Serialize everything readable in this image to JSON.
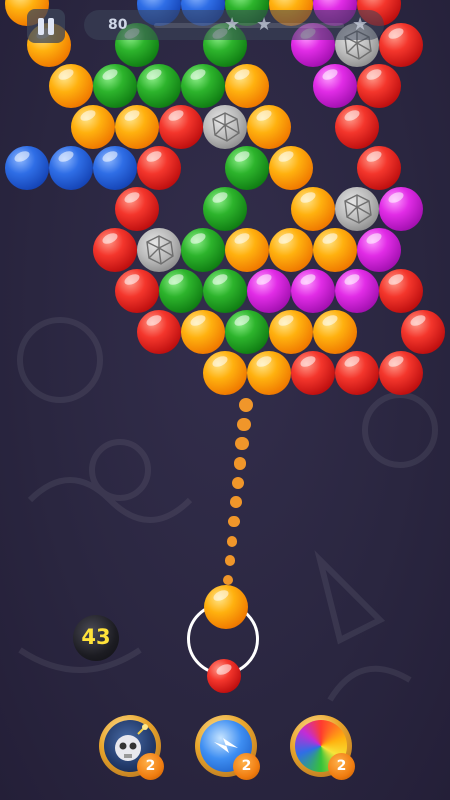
{
  "hud": {
    "score": "80"
  },
  "shots_remaining": "43",
  "loaded_bubble": "orange",
  "next_bubble": "red",
  "bubbles": [
    {
      "c": "orange",
      "col": 0,
      "row": 0
    },
    {
      "c": "blue",
      "col": 3,
      "row": 0
    },
    {
      "c": "blue",
      "col": 4,
      "row": 0
    },
    {
      "c": "green",
      "col": 5,
      "row": 0
    },
    {
      "c": "orange",
      "col": 6,
      "row": 0
    },
    {
      "c": "magenta",
      "col": 7,
      "row": 0
    },
    {
      "c": "red",
      "col": 8,
      "row": 0
    },
    {
      "c": "orange",
      "col": 0,
      "row": 1
    },
    {
      "c": "green",
      "col": 2,
      "row": 1
    },
    {
      "c": "green",
      "col": 4,
      "row": 1
    },
    {
      "c": "magenta",
      "col": 6,
      "row": 1
    },
    {
      "c": "rock",
      "col": 7,
      "row": 1
    },
    {
      "c": "red",
      "col": 8,
      "row": 1
    },
    {
      "c": "orange",
      "col": 1,
      "row": 2
    },
    {
      "c": "green",
      "col": 2,
      "row": 2
    },
    {
      "c": "green",
      "col": 3,
      "row": 2
    },
    {
      "c": "green",
      "col": 4,
      "row": 2
    },
    {
      "c": "orange",
      "col": 5,
      "row": 2
    },
    {
      "c": "magenta",
      "col": 7,
      "row": 2
    },
    {
      "c": "red",
      "col": 8,
      "row": 2
    },
    {
      "c": "orange",
      "col": 1,
      "row": 3
    },
    {
      "c": "orange",
      "col": 2,
      "row": 3
    },
    {
      "c": "red",
      "col": 3,
      "row": 3
    },
    {
      "c": "rock",
      "col": 4,
      "row": 3
    },
    {
      "c": "orange",
      "col": 5,
      "row": 3
    },
    {
      "c": "red",
      "col": 7,
      "row": 3
    },
    {
      "c": "blue",
      "col": 0,
      "row": 4
    },
    {
      "c": "blue",
      "col": 1,
      "row": 4
    },
    {
      "c": "blue",
      "col": 2,
      "row": 4
    },
    {
      "c": "red",
      "col": 3,
      "row": 4
    },
    {
      "c": "green",
      "col": 5,
      "row": 4
    },
    {
      "c": "orange",
      "col": 6,
      "row": 4
    },
    {
      "c": "red",
      "col": 8,
      "row": 4
    },
    {
      "c": "red",
      "col": 2,
      "row": 5
    },
    {
      "c": "green",
      "col": 4,
      "row": 5
    },
    {
      "c": "orange",
      "col": 6,
      "row": 5
    },
    {
      "c": "rock",
      "col": 7,
      "row": 5
    },
    {
      "c": "magenta",
      "col": 8,
      "row": 5
    },
    {
      "c": "red",
      "col": 2,
      "row": 6
    },
    {
      "c": "rock",
      "col": 3,
      "row": 6
    },
    {
      "c": "green",
      "col": 4,
      "row": 6
    },
    {
      "c": "orange",
      "col": 5,
      "row": 6
    },
    {
      "c": "orange",
      "col": 6,
      "row": 6
    },
    {
      "c": "orange",
      "col": 7,
      "row": 6
    },
    {
      "c": "magenta",
      "col": 8,
      "row": 6
    },
    {
      "c": "red",
      "col": 2,
      "row": 7
    },
    {
      "c": "green",
      "col": 3,
      "row": 7
    },
    {
      "c": "green",
      "col": 4,
      "row": 7
    },
    {
      "c": "magenta",
      "col": 5,
      "row": 7
    },
    {
      "c": "magenta",
      "col": 6,
      "row": 7
    },
    {
      "c": "magenta",
      "col": 7,
      "row": 7
    },
    {
      "c": "red",
      "col": 8,
      "row": 7
    },
    {
      "c": "red",
      "col": 3,
      "row": 8
    },
    {
      "c": "orange",
      "col": 4,
      "row": 8
    },
    {
      "c": "green",
      "col": 5,
      "row": 8
    },
    {
      "c": "orange",
      "col": 6,
      "row": 8
    },
    {
      "c": "orange",
      "col": 7,
      "row": 8
    },
    {
      "c": "red",
      "col": 9,
      "row": 8
    },
    {
      "c": "orange",
      "col": 4,
      "row": 9
    },
    {
      "c": "orange",
      "col": 5,
      "row": 9
    },
    {
      "c": "red",
      "col": 6,
      "row": 9
    },
    {
      "c": "red",
      "col": 7,
      "row": 9
    },
    {
      "c": "red",
      "col": 8,
      "row": 9
    }
  ],
  "aim_path_dots": 10,
  "boosters": [
    {
      "name": "bomb-booster",
      "icon": "skull-bomb-icon",
      "count": "2"
    },
    {
      "name": "lightning-booster",
      "icon": "lightning-icon",
      "count": "2"
    },
    {
      "name": "rainbow-booster",
      "icon": "rainbow-ball-icon",
      "count": "2"
    }
  ],
  "colors": {
    "background": "#2b2740",
    "aim_dot": "#f0962a",
    "counter_text": "#ffe23a",
    "badge": "#f07d10"
  }
}
